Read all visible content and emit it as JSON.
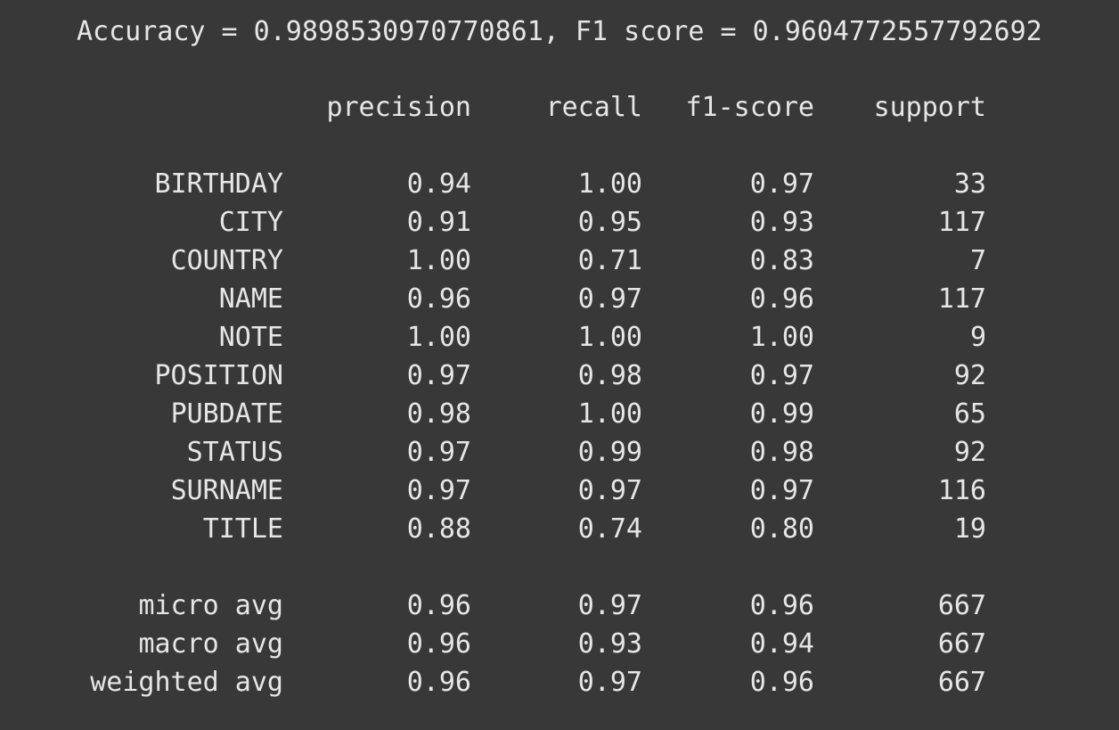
{
  "summary": {
    "text": "Accuracy = 0.9898530970770861, F1 score = 0.9604772557792692"
  },
  "report": {
    "headers": {
      "precision": "precision",
      "recall": "recall",
      "f1": "f1-score",
      "support": "support"
    },
    "rows": [
      {
        "label": "BIRTHDAY",
        "precision": "0.94",
        "recall": "1.00",
        "f1": "0.97",
        "support": "33"
      },
      {
        "label": "CITY",
        "precision": "0.91",
        "recall": "0.95",
        "f1": "0.93",
        "support": "117"
      },
      {
        "label": "COUNTRY",
        "precision": "1.00",
        "recall": "0.71",
        "f1": "0.83",
        "support": "7"
      },
      {
        "label": "NAME",
        "precision": "0.96",
        "recall": "0.97",
        "f1": "0.96",
        "support": "117"
      },
      {
        "label": "NOTE",
        "precision": "1.00",
        "recall": "1.00",
        "f1": "1.00",
        "support": "9"
      },
      {
        "label": "POSITION",
        "precision": "0.97",
        "recall": "0.98",
        "f1": "0.97",
        "support": "92"
      },
      {
        "label": "PUBDATE",
        "precision": "0.98",
        "recall": "1.00",
        "f1": "0.99",
        "support": "65"
      },
      {
        "label": "STATUS",
        "precision": "0.97",
        "recall": "0.99",
        "f1": "0.98",
        "support": "92"
      },
      {
        "label": "SURNAME",
        "precision": "0.97",
        "recall": "0.97",
        "f1": "0.97",
        "support": "116"
      },
      {
        "label": "TITLE",
        "precision": "0.88",
        "recall": "0.74",
        "f1": "0.80",
        "support": "19"
      }
    ],
    "averages": [
      {
        "label": "micro avg",
        "precision": "0.96",
        "recall": "0.97",
        "f1": "0.96",
        "support": "667"
      },
      {
        "label": "macro avg",
        "precision": "0.96",
        "recall": "0.93",
        "f1": "0.94",
        "support": "667"
      },
      {
        "label": "weighted avg",
        "precision": "0.96",
        "recall": "0.97",
        "f1": "0.96",
        "support": "667"
      }
    ]
  }
}
